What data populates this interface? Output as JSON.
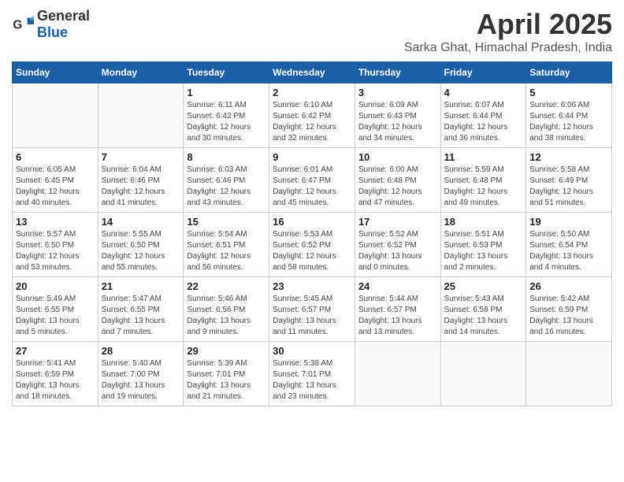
{
  "header": {
    "logo_general": "General",
    "logo_blue": "Blue",
    "month_year": "April 2025",
    "location": "Sarka Ghat, Himachal Pradesh, India"
  },
  "weekdays": [
    "Sunday",
    "Monday",
    "Tuesday",
    "Wednesday",
    "Thursday",
    "Friday",
    "Saturday"
  ],
  "weeks": [
    [
      {
        "day": "",
        "info": ""
      },
      {
        "day": "",
        "info": ""
      },
      {
        "day": "1",
        "info": "Sunrise: 6:11 AM\nSunset: 6:42 PM\nDaylight: 12 hours and 30 minutes."
      },
      {
        "day": "2",
        "info": "Sunrise: 6:10 AM\nSunset: 6:42 PM\nDaylight: 12 hours and 32 minutes."
      },
      {
        "day": "3",
        "info": "Sunrise: 6:09 AM\nSunset: 6:43 PM\nDaylight: 12 hours and 34 minutes."
      },
      {
        "day": "4",
        "info": "Sunrise: 6:07 AM\nSunset: 6:44 PM\nDaylight: 12 hours and 36 minutes."
      },
      {
        "day": "5",
        "info": "Sunrise: 6:06 AM\nSunset: 6:44 PM\nDaylight: 12 hours and 38 minutes."
      }
    ],
    [
      {
        "day": "6",
        "info": "Sunrise: 6:05 AM\nSunset: 6:45 PM\nDaylight: 12 hours and 40 minutes."
      },
      {
        "day": "7",
        "info": "Sunrise: 6:04 AM\nSunset: 6:46 PM\nDaylight: 12 hours and 41 minutes."
      },
      {
        "day": "8",
        "info": "Sunrise: 6:03 AM\nSunset: 6:46 PM\nDaylight: 12 hours and 43 minutes."
      },
      {
        "day": "9",
        "info": "Sunrise: 6:01 AM\nSunset: 6:47 PM\nDaylight: 12 hours and 45 minutes."
      },
      {
        "day": "10",
        "info": "Sunrise: 6:00 AM\nSunset: 6:48 PM\nDaylight: 12 hours and 47 minutes."
      },
      {
        "day": "11",
        "info": "Sunrise: 5:59 AM\nSunset: 6:48 PM\nDaylight: 12 hours and 49 minutes."
      },
      {
        "day": "12",
        "info": "Sunrise: 5:58 AM\nSunset: 6:49 PM\nDaylight: 12 hours and 51 minutes."
      }
    ],
    [
      {
        "day": "13",
        "info": "Sunrise: 5:57 AM\nSunset: 6:50 PM\nDaylight: 12 hours and 53 minutes."
      },
      {
        "day": "14",
        "info": "Sunrise: 5:55 AM\nSunset: 6:50 PM\nDaylight: 12 hours and 55 minutes."
      },
      {
        "day": "15",
        "info": "Sunrise: 5:54 AM\nSunset: 6:51 PM\nDaylight: 12 hours and 56 minutes."
      },
      {
        "day": "16",
        "info": "Sunrise: 5:53 AM\nSunset: 6:52 PM\nDaylight: 12 hours and 58 minutes."
      },
      {
        "day": "17",
        "info": "Sunrise: 5:52 AM\nSunset: 6:52 PM\nDaylight: 13 hours and 0 minutes."
      },
      {
        "day": "18",
        "info": "Sunrise: 5:51 AM\nSunset: 6:53 PM\nDaylight: 13 hours and 2 minutes."
      },
      {
        "day": "19",
        "info": "Sunrise: 5:50 AM\nSunset: 6:54 PM\nDaylight: 13 hours and 4 minutes."
      }
    ],
    [
      {
        "day": "20",
        "info": "Sunrise: 5:49 AM\nSunset: 6:55 PM\nDaylight: 13 hours and 5 minutes."
      },
      {
        "day": "21",
        "info": "Sunrise: 5:47 AM\nSunset: 6:55 PM\nDaylight: 13 hours and 7 minutes."
      },
      {
        "day": "22",
        "info": "Sunrise: 5:46 AM\nSunset: 6:56 PM\nDaylight: 13 hours and 9 minutes."
      },
      {
        "day": "23",
        "info": "Sunrise: 5:45 AM\nSunset: 6:57 PM\nDaylight: 13 hours and 11 minutes."
      },
      {
        "day": "24",
        "info": "Sunrise: 5:44 AM\nSunset: 6:57 PM\nDaylight: 13 hours and 13 minutes."
      },
      {
        "day": "25",
        "info": "Sunrise: 5:43 AM\nSunset: 6:58 PM\nDaylight: 13 hours and 14 minutes."
      },
      {
        "day": "26",
        "info": "Sunrise: 5:42 AM\nSunset: 6:59 PM\nDaylight: 13 hours and 16 minutes."
      }
    ],
    [
      {
        "day": "27",
        "info": "Sunrise: 5:41 AM\nSunset: 6:59 PM\nDaylight: 13 hours and 18 minutes."
      },
      {
        "day": "28",
        "info": "Sunrise: 5:40 AM\nSunset: 7:00 PM\nDaylight: 13 hours and 19 minutes."
      },
      {
        "day": "29",
        "info": "Sunrise: 5:39 AM\nSunset: 7:01 PM\nDaylight: 13 hours and 21 minutes."
      },
      {
        "day": "30",
        "info": "Sunrise: 5:38 AM\nSunset: 7:01 PM\nDaylight: 13 hours and 23 minutes."
      },
      {
        "day": "",
        "info": ""
      },
      {
        "day": "",
        "info": ""
      },
      {
        "day": "",
        "info": ""
      }
    ]
  ]
}
